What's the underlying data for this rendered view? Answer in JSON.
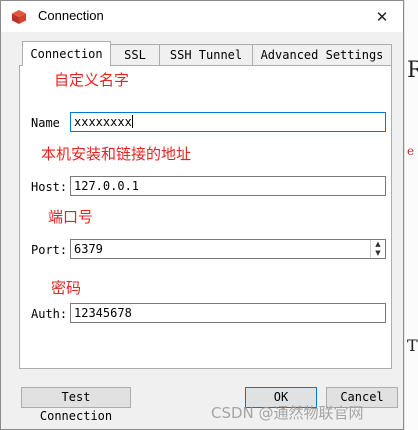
{
  "window": {
    "title": "Connection",
    "close_glyph": "✕",
    "app_icon": "redis-cube-icon"
  },
  "background_app": {
    "letters": [
      "R",
      "e",
      "T"
    ]
  },
  "tabs": [
    {
      "label": "Connection",
      "active": true
    },
    {
      "label": "SSL",
      "active": false
    },
    {
      "label": "SSH Tunnel",
      "active": false
    },
    {
      "label": "Advanced Settings",
      "active": false
    }
  ],
  "annotations": {
    "name_hint": "自定义名字",
    "host_hint": "本机安装和链接的地址",
    "port_hint": "端口号",
    "auth_hint": "密码"
  },
  "form": {
    "name_label": "Name",
    "name_value": "xxxxxxxx",
    "host_label": "Host:",
    "host_value": "127.0.0.1",
    "port_label": "Port:",
    "port_value": "6379",
    "auth_label": "Auth:",
    "auth_value": "12345678"
  },
  "buttons": {
    "test": "Test Connection",
    "ok": "OK",
    "cancel": "Cancel"
  },
  "watermark": "CSDN @通然物联官网",
  "colors": {
    "annotation": "#e8231f",
    "focus": "#0078d7"
  }
}
